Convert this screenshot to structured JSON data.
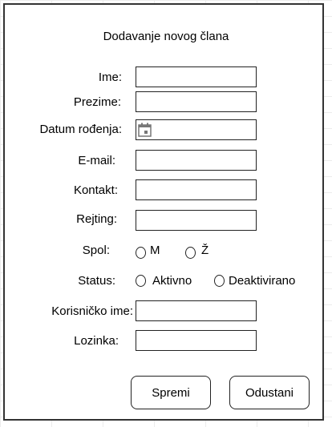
{
  "form": {
    "title": "Dodavanje novog člana",
    "fields": {
      "ime": {
        "label": "Ime:",
        "value": ""
      },
      "prezime": {
        "label": "Prezime:",
        "value": ""
      },
      "datum": {
        "label": "Datum rođenja:",
        "value": "",
        "icon": "calendar-icon"
      },
      "email": {
        "label": "E-mail:",
        "value": ""
      },
      "kontakt": {
        "label": "Kontakt:",
        "value": ""
      },
      "rejting": {
        "label": "Rejting:",
        "value": ""
      },
      "korisnicko_ime": {
        "label": "Korisničko ime:",
        "value": ""
      },
      "lozinka": {
        "label": "Lozinka:",
        "value": ""
      }
    },
    "spol": {
      "label": "Spol:",
      "options": [
        "M",
        "Ž"
      ],
      "selected": null
    },
    "status": {
      "label": "Status:",
      "options": [
        "Aktivno",
        "Deaktivirano"
      ],
      "selected": null
    },
    "buttons": {
      "save": "Spremi",
      "cancel": "Odustani"
    }
  }
}
